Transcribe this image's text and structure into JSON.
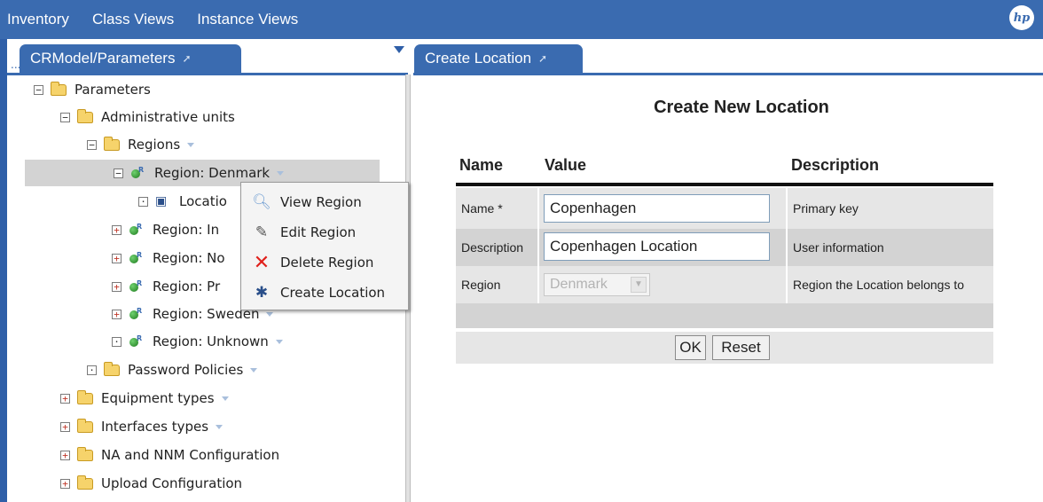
{
  "topnav": {
    "items": [
      "Inventory",
      "Class Views",
      "Instance Views"
    ],
    "logo": "hp"
  },
  "left_tab": {
    "title": "CRModel/Parameters",
    "ellipsis": "..."
  },
  "right_tab": {
    "title": "Create Location"
  },
  "tree": {
    "root": "Parameters",
    "admin_units": "Administrative units",
    "regions": "Regions",
    "region_denmark": "Region: Denmark",
    "location_truncated": "Locatio",
    "region_in": "Region: In",
    "region_no": "Region: No",
    "region_pr": "Region: Pr",
    "region_sweden": "Region: Sweden",
    "region_unknown": "Region: Unknown",
    "password_policies": "Password Policies",
    "equipment_types": "Equipment types",
    "interfaces_types": "Interfaces types",
    "na_nnm": "NA and NNM Configuration",
    "upload_config": "Upload Configuration"
  },
  "context_menu": {
    "items": [
      {
        "label": "View Region",
        "icon": "magnifier-icon"
      },
      {
        "label": "Edit Region",
        "icon": "edit-icon"
      },
      {
        "label": "Delete Region",
        "icon": "delete-x-icon"
      },
      {
        "label": "Create Location",
        "icon": "create-location-icon"
      }
    ]
  },
  "form": {
    "title": "Create New Location",
    "headers": {
      "name": "Name",
      "value": "Value",
      "description": "Description"
    },
    "rows": [
      {
        "name": "Name *",
        "value": "Copenhagen",
        "description": "Primary key"
      },
      {
        "name": "Description",
        "value": "Copenhagen Location",
        "description": "User information"
      },
      {
        "name": "Region",
        "value": "Denmark",
        "description": "Region the Location belongs to"
      }
    ],
    "ok_label": "OK",
    "reset_label": "Reset"
  },
  "colors": {
    "bar_blue": "#3a6bb0",
    "selected_row": "#d3d3d3"
  }
}
